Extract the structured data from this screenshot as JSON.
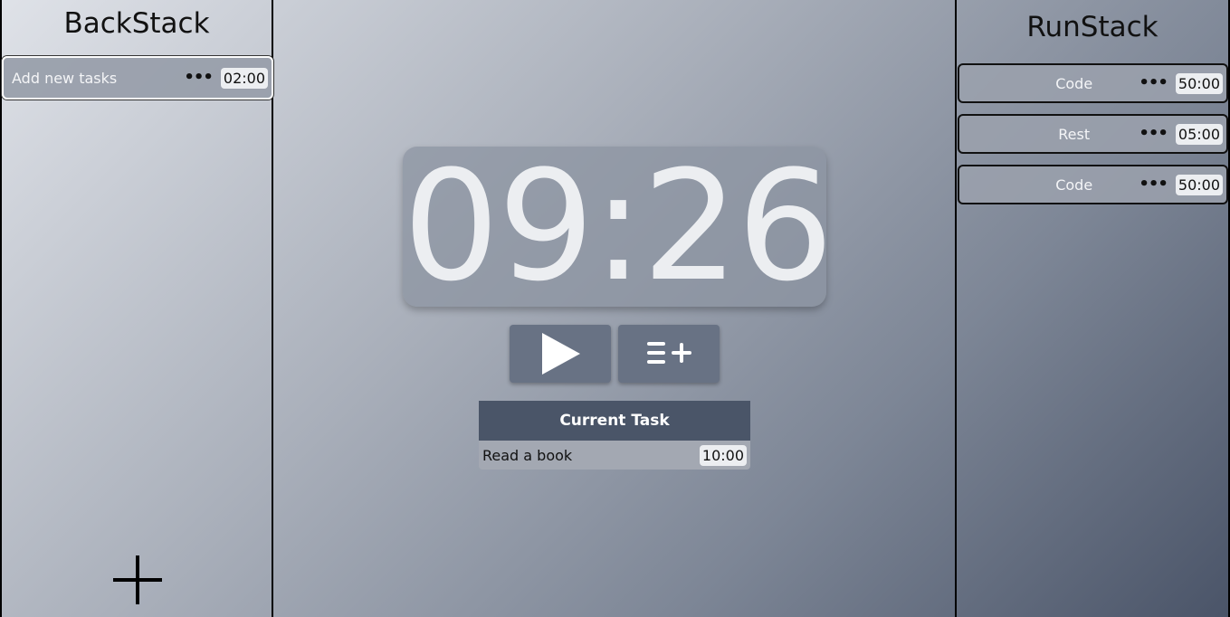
{
  "backstack": {
    "title": "BackStack",
    "tasks": [
      {
        "label": "Add new tasks",
        "menu": "•••",
        "time": "02:00"
      }
    ],
    "add_icon": "plus-icon"
  },
  "timer": {
    "display": "09:26",
    "play_icon": "play-icon",
    "queue_icon": "list-add-icon"
  },
  "current_task": {
    "header": "Current Task",
    "label": "Read a book",
    "time": "10:00"
  },
  "runstack": {
    "title": "RunStack",
    "tasks": [
      {
        "label": "Code",
        "menu": "•••",
        "time": "50:00"
      },
      {
        "label": "Rest",
        "menu": "•••",
        "time": "05:00"
      },
      {
        "label": "Code",
        "menu": "•••",
        "time": "50:00"
      }
    ]
  }
}
